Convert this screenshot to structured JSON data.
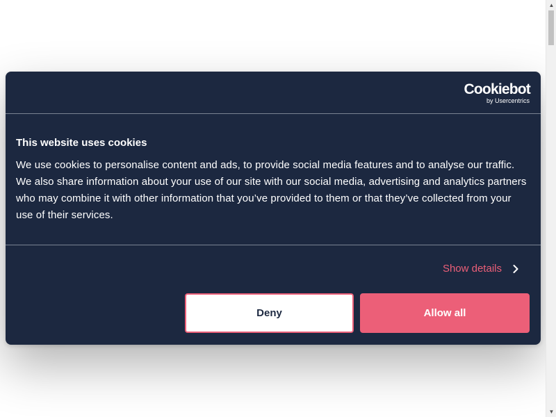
{
  "scrollbar": {
    "up_arrow": "▲",
    "down_arrow": "▼"
  },
  "dialog": {
    "logo": {
      "name": "Cookiebot",
      "tagline": "by Usercentrics"
    },
    "title": "This website uses cookies",
    "body": "We use cookies to personalise content and ads, to provide social media features and to analyse our traffic. We also share information about your use of our site with our social media, advertising and analytics partners who may combine it with other information that you’ve provided to them or that they’ve collected from your use of their services.",
    "show_details_label": "Show details",
    "deny_label": "Deny",
    "allow_all_label": "Allow all"
  },
  "colors": {
    "dialog_background": "#1c2840",
    "accent": "#ec5f78",
    "divider": "#7b8393",
    "text": "#ffffff"
  },
  "icons": {
    "show_details": "chevron-right-icon",
    "scroll_up": "scroll-up-arrow-icon",
    "scroll_down": "scroll-down-arrow-icon"
  }
}
